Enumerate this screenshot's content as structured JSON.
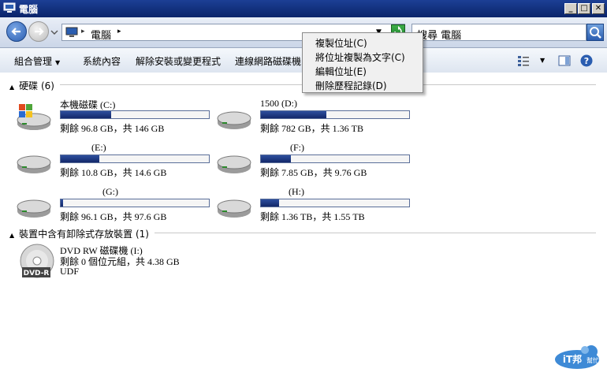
{
  "window": {
    "title": "電腦"
  },
  "address": {
    "crumb": "電腦",
    "search_placeholder": "搜尋 電腦"
  },
  "toolbar": {
    "items": [
      "組合管理",
      "系統內容",
      "解除安裝或變更程式",
      "連線網路磁碟機"
    ]
  },
  "groups": {
    "hard_disks": {
      "header": "硬碟 (6)"
    },
    "removable": {
      "header": "裝置中含有卸除式存放裝置 (1)"
    }
  },
  "drives": [
    {
      "name": "本機磁碟 (C:)",
      "free_text": "剩餘 96.8 GB，共 146 GB",
      "used_fraction": 0.34
    },
    {
      "name": "1500 (D:)",
      "free_text": "剩餘 782 GB，共 1.36 TB",
      "used_fraction": 0.44
    },
    {
      "name": "(E:)",
      "free_text": "剩餘 10.8 GB，共 14.6 GB",
      "used_fraction": 0.26
    },
    {
      "name": "(F:)",
      "free_text": "剩餘 7.85 GB，共 9.76 GB",
      "used_fraction": 0.2
    },
    {
      "name": "(G:)",
      "free_text": "剩餘 96.1 GB，共 97.6 GB",
      "used_fraction": 0.015
    },
    {
      "name": "(H:)",
      "free_text": "剩餘 1.36 TB，共 1.55 TB",
      "used_fraction": 0.12
    }
  ],
  "dvd": {
    "name": "DVD RW 磁碟機 (I:)",
    "free_text": "剩餘 0 個位元組，共 4.38 GB",
    "fs": "UDF",
    "badge": "DVD-R"
  },
  "context_menu": {
    "items": [
      "複製位址(C)",
      "將位址複製為文字(C)",
      "編輯位址(E)",
      "刪除歷程記錄(D)"
    ]
  },
  "logo": {
    "text": "iT邦",
    "sub": "幫忙"
  },
  "colors": {
    "title_bar": "#0a246a",
    "usage_bar": "#13286a"
  }
}
